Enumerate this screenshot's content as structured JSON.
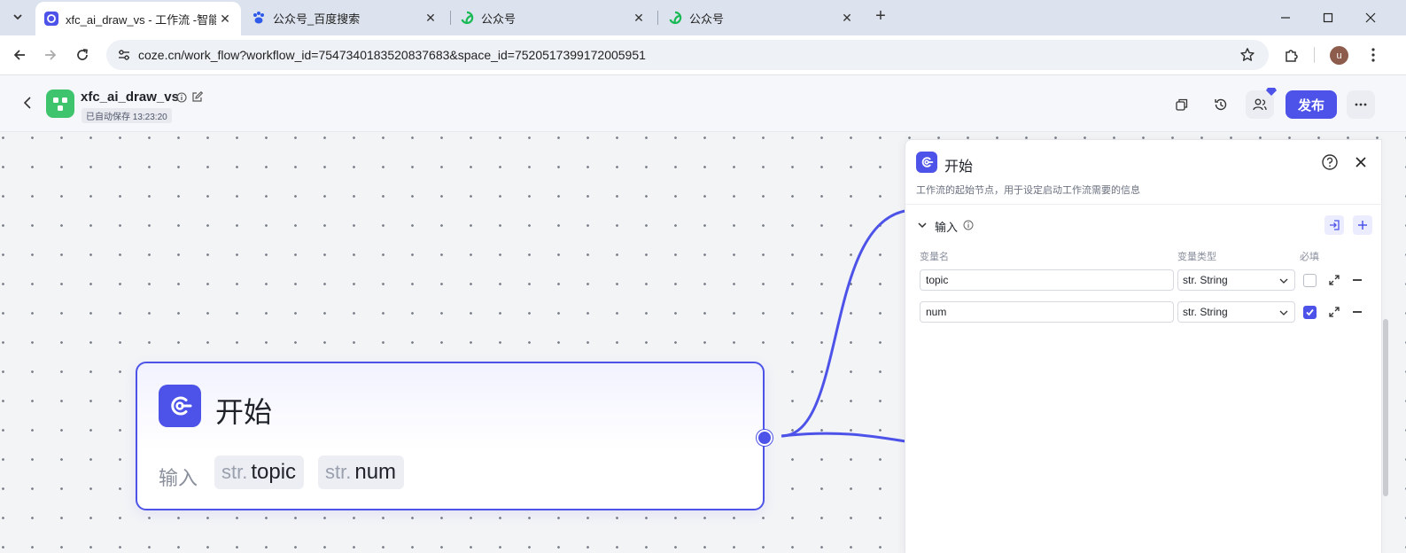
{
  "browser": {
    "tabs": [
      {
        "title": "xfc_ai_draw_vs - 工作流 -智能",
        "active": true
      },
      {
        "title": "公众号_百度搜索",
        "active": false
      },
      {
        "title": "公众号",
        "active": false
      },
      {
        "title": "公众号",
        "active": false
      }
    ],
    "url": "coze.cn/work_flow?workflow_id=7547340183520837683&space_id=7520517399172005951",
    "profile_initial": "u"
  },
  "header": {
    "workflow_name": "xfc_ai_draw_vs",
    "autosave_text": "已自动保存 13:23:20",
    "publish_label": "发布"
  },
  "node": {
    "title": "开始",
    "input_label": "输入",
    "params": [
      {
        "type": "str.",
        "name": "topic"
      },
      {
        "type": "str.",
        "name": "num"
      }
    ]
  },
  "panel": {
    "title": "开始",
    "description": "工作流的起始节点，用于设定启动工作流需要的信息",
    "section_title": "输入",
    "columns": {
      "name": "变量名",
      "type": "变量类型",
      "required": "必填"
    },
    "rows": [
      {
        "name": "topic",
        "type": "str. String",
        "required": false
      },
      {
        "name": "num",
        "type": "str. String",
        "required": true
      }
    ]
  },
  "colors": {
    "accent": "#4d53e8",
    "logo_green": "#3ec46d"
  }
}
